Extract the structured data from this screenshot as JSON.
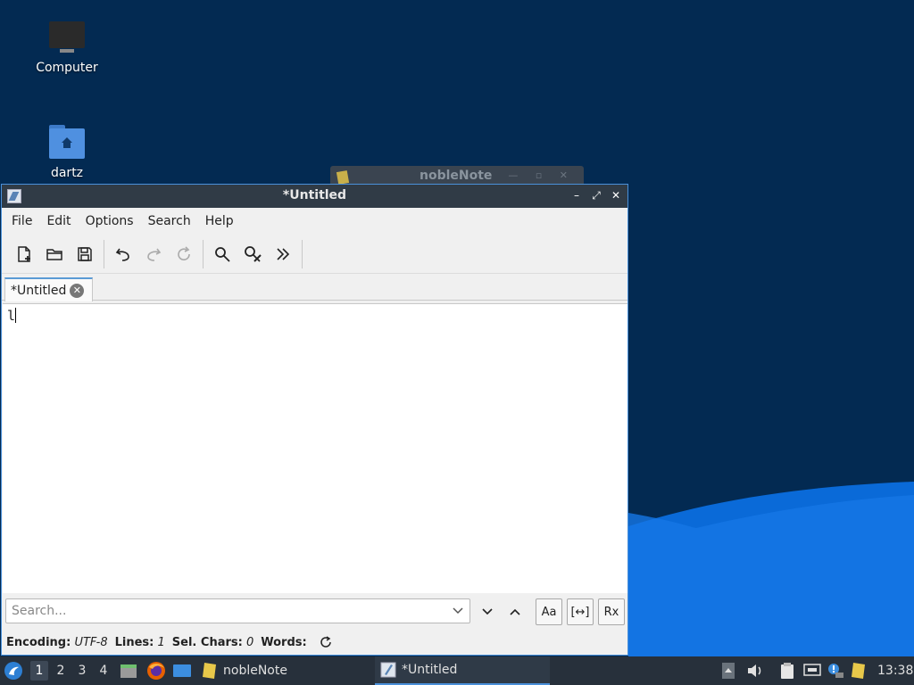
{
  "desktop": {
    "icons": [
      {
        "label": "Computer",
        "icon": "computer-icon"
      },
      {
        "label": "dartz",
        "icon": "home-folder-icon"
      }
    ],
    "background_window_title": "nobleNote",
    "colors": {
      "background": "#032a52",
      "wave": "#0a6ad8"
    }
  },
  "window": {
    "title": "*Untitled",
    "menu": [
      "File",
      "Edit",
      "Options",
      "Search",
      "Help"
    ],
    "toolbar": [
      "new-document-icon",
      "open-folder-icon",
      "save-icon",
      "undo-icon",
      "redo-icon",
      "reload-icon",
      "find-icon",
      "replace-icon",
      "more-icon"
    ],
    "tab": {
      "label": "*Untitled"
    },
    "editor_text": "l",
    "search": {
      "placeholder": "Search...",
      "match_case_label": "Aa",
      "whole_word_label": "[↔]",
      "regex_label": "Rx"
    },
    "status": {
      "encoding_label": "Encoding:",
      "encoding_value": "UTF-8",
      "lines_label": "Lines:",
      "lines_value": "1",
      "sel_label": "Sel. Chars:",
      "sel_value": "0",
      "words_label": "Words:"
    }
  },
  "taskbar": {
    "workspaces": [
      "1",
      "2",
      "3",
      "4"
    ],
    "tasks": [
      {
        "label": "nobleNote",
        "icon": "note-icon"
      },
      {
        "label": "*Untitled",
        "icon": "text-editor-icon"
      }
    ],
    "clock": "13:38"
  }
}
